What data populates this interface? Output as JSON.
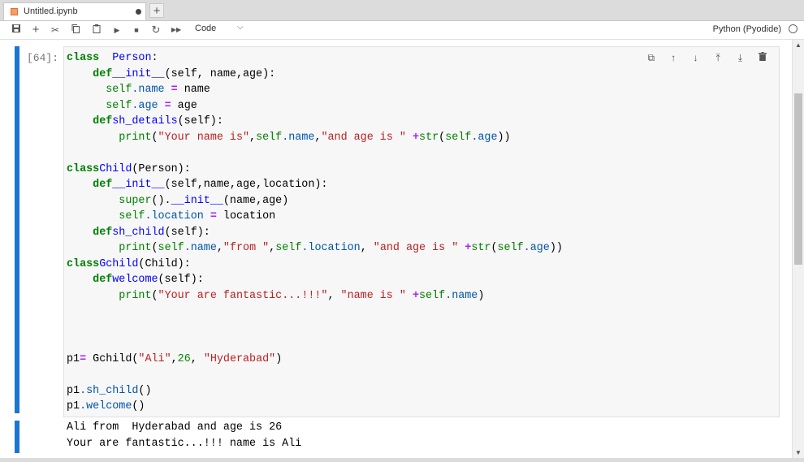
{
  "tab": {
    "title": "Untitled.ipynb",
    "add": "+"
  },
  "toolbar": {
    "cell_type": "Code",
    "kernel": "Python (Pyodide)",
    "icons": [
      "save-icon",
      "add-icon",
      "cut-icon",
      "copy-icon",
      "paste-icon",
      "run-icon",
      "stop-icon",
      "restart-icon",
      "run-all-icon",
      "chevron-down-icon",
      "kernel-status-icon"
    ]
  },
  "cell": {
    "prompt": "[64]:",
    "code": [
      [
        [
          "k",
          "class"
        ],
        [
          "",
          "  "
        ],
        [
          "d",
          "Person"
        ],
        [
          "",
          ":"
        ]
      ],
      [
        [
          "",
          "    "
        ],
        [
          "k",
          "def"
        ],
        [
          "",
          ""
        ],
        [
          "d",
          "__init__"
        ],
        [
          "",
          "(self, name,age):"
        ]
      ],
      [
        [
          "",
          "      "
        ],
        [
          "b",
          "self"
        ],
        [
          "",
          ""
        ],
        [
          "v",
          ".name"
        ],
        [
          "",
          " "
        ],
        [
          "o",
          "="
        ],
        [
          "",
          " name"
        ]
      ],
      [
        [
          "",
          "      "
        ],
        [
          "b",
          "self"
        ],
        [
          "",
          ""
        ],
        [
          "v",
          ".age"
        ],
        [
          "",
          " "
        ],
        [
          "o",
          "="
        ],
        [
          "",
          " age"
        ]
      ],
      [
        [
          "",
          "    "
        ],
        [
          "k",
          "def"
        ],
        [
          "",
          ""
        ],
        [
          "d",
          "sh_details"
        ],
        [
          "",
          "(self):"
        ]
      ],
      [
        [
          "",
          "        "
        ],
        [
          "b",
          "print"
        ],
        [
          "",
          "("
        ],
        [
          "s",
          "\"Your name is\""
        ],
        [
          "",
          ","
        ],
        [
          "b",
          "self"
        ],
        [
          "v",
          ".name"
        ],
        [
          "",
          ","
        ],
        [
          "s",
          "\"and age is \""
        ],
        [
          "",
          " "
        ],
        [
          "o",
          "+"
        ],
        [
          "b",
          "str"
        ],
        [
          "",
          "("
        ],
        [
          "b",
          "self"
        ],
        [
          "v",
          ".age"
        ],
        [
          "",
          "))"
        ]
      ],
      [],
      [
        [
          "k",
          "class"
        ],
        [
          "",
          ""
        ],
        [
          "d",
          "Child"
        ],
        [
          "",
          "(Person):"
        ]
      ],
      [
        [
          "",
          "    "
        ],
        [
          "k",
          "def"
        ],
        [
          "",
          ""
        ],
        [
          "d",
          "__init__"
        ],
        [
          "",
          "(self,name,age,location):"
        ]
      ],
      [
        [
          "",
          "        "
        ],
        [
          "b",
          "super"
        ],
        [
          "",
          "()."
        ],
        [
          "d",
          "__init__"
        ],
        [
          "",
          "(name,age)"
        ]
      ],
      [
        [
          "",
          "        "
        ],
        [
          "b",
          "self"
        ],
        [
          "v",
          ".location"
        ],
        [
          "",
          " "
        ],
        [
          "o",
          "="
        ],
        [
          "",
          " location"
        ]
      ],
      [
        [
          "",
          "    "
        ],
        [
          "k",
          "def"
        ],
        [
          "",
          ""
        ],
        [
          "d",
          "sh_child"
        ],
        [
          "",
          "(self):"
        ]
      ],
      [
        [
          "",
          "        "
        ],
        [
          "b",
          "print"
        ],
        [
          "",
          "("
        ],
        [
          "b",
          "self"
        ],
        [
          "v",
          ".name"
        ],
        [
          "",
          ","
        ],
        [
          "s",
          "\"from \""
        ],
        [
          "",
          ","
        ],
        [
          "b",
          "self"
        ],
        [
          "v",
          ".location"
        ],
        [
          "",
          ", "
        ],
        [
          "s",
          "\"and age is \""
        ],
        [
          "",
          " "
        ],
        [
          "o",
          "+"
        ],
        [
          "b",
          "str"
        ],
        [
          "",
          "("
        ],
        [
          "b",
          "self"
        ],
        [
          "v",
          ".age"
        ],
        [
          "",
          "))"
        ]
      ],
      [
        [
          "k",
          "class"
        ],
        [
          "",
          ""
        ],
        [
          "d",
          "Gchild"
        ],
        [
          "",
          "(Child):"
        ]
      ],
      [
        [
          "",
          "    "
        ],
        [
          "k",
          "def"
        ],
        [
          "",
          ""
        ],
        [
          "d",
          "welcome"
        ],
        [
          "",
          "(self):"
        ]
      ],
      [
        [
          "",
          "        "
        ],
        [
          "b",
          "print"
        ],
        [
          "",
          "("
        ],
        [
          "s",
          "\"Your are fantastic...!!!\""
        ],
        [
          "",
          ", "
        ],
        [
          "s",
          "\"name is \""
        ],
        [
          "",
          " "
        ],
        [
          "o",
          "+"
        ],
        [
          "b",
          "self"
        ],
        [
          "v",
          ".name"
        ],
        [
          "",
          ")"
        ]
      ],
      [],
      [],
      [],
      [
        [
          "",
          "p1"
        ],
        [
          "o",
          "="
        ],
        [
          "",
          " Gchild("
        ],
        [
          "s",
          "\"Ali\""
        ],
        [
          "",
          ","
        ],
        [
          "n",
          "26"
        ],
        [
          "",
          ", "
        ],
        [
          "s",
          "\"Hyderabad\""
        ],
        [
          "",
          ")"
        ]
      ],
      [],
      [
        [
          "",
          "p1"
        ],
        [
          "v",
          ".sh_child"
        ],
        [
          "",
          "()"
        ]
      ],
      [
        [
          "",
          "p1"
        ],
        [
          "v",
          ".welcome"
        ],
        [
          "",
          "()"
        ]
      ]
    ],
    "output": [
      "Ali from  Hyderabad and age is 26",
      "Your are fantastic...!!! name is Ali"
    ]
  }
}
